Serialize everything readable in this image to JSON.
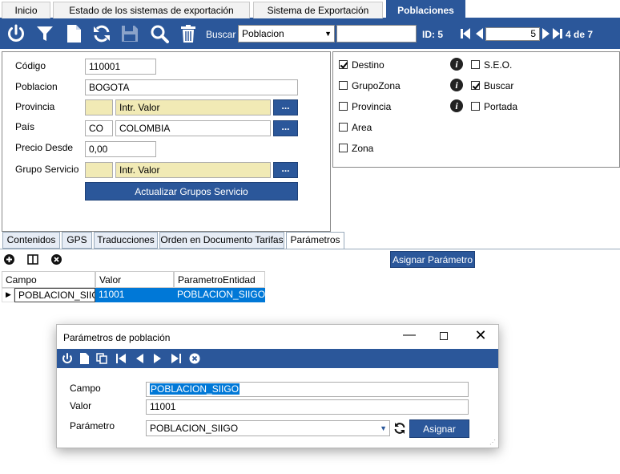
{
  "tabs": [
    "Inicio",
    "Estado de los sistemas de exportación",
    "Sistema de Exportación",
    "Poblaciones"
  ],
  "toolbar": {
    "buscar_label": "Buscar",
    "search_field": "Poblacion",
    "search_value": "",
    "id_label": "ID: 5",
    "record_number": "5",
    "record_count": "4 de 7"
  },
  "form": {
    "codigo_label": "Código",
    "codigo_value": "110001",
    "poblacion_label": "Poblacion",
    "poblacion_value": "BOGOTA",
    "provincia_label": "Provincia",
    "provincia_code": "",
    "provincia_value": "Intr. Valor",
    "pais_label": "País",
    "pais_code": "CO",
    "pais_value": "COLOMBIA",
    "precio_label": "Precio Desde",
    "precio_value": "0,00",
    "grupo_label": "Grupo Servicio",
    "grupo_code": "",
    "grupo_value": "Intr. Valor",
    "lookup_button": "...",
    "actualizar_button": "Actualizar Grupos Servicio"
  },
  "checks": {
    "destino": "Destino",
    "grupozona": "GrupoZona",
    "provincia": "Provincia",
    "area": "Area",
    "zona": "Zona",
    "seo": "S.E.O.",
    "buscar": "Buscar",
    "portada": "Portada",
    "info_glyph": "i"
  },
  "bottom_tabs": [
    "Contenidos",
    "GPS",
    "Traducciones",
    "Orden en Documento Tarifas",
    "Parámetros"
  ],
  "grid": {
    "asignar_button": "Asignar Parámetro",
    "headers": [
      "Campo",
      "Valor",
      "ParametroEntidad"
    ],
    "row": [
      "POBLACION_SIIGO",
      "11001",
      "POBLACION_SIIGO"
    ]
  },
  "dialog": {
    "title": "Parámetros de población",
    "campo_label": "Campo",
    "campo_value": "POBLACION_SIIGO",
    "valor_label": "Valor",
    "valor_value": "11001",
    "parametro_label": "Parámetro",
    "parametro_value": "POBLACION_SIIGO",
    "asignar_button": "Asignar"
  },
  "colors": {
    "accent": "#2b579a",
    "yellow_field": "#f1eab5",
    "selection": "#0078d7"
  }
}
